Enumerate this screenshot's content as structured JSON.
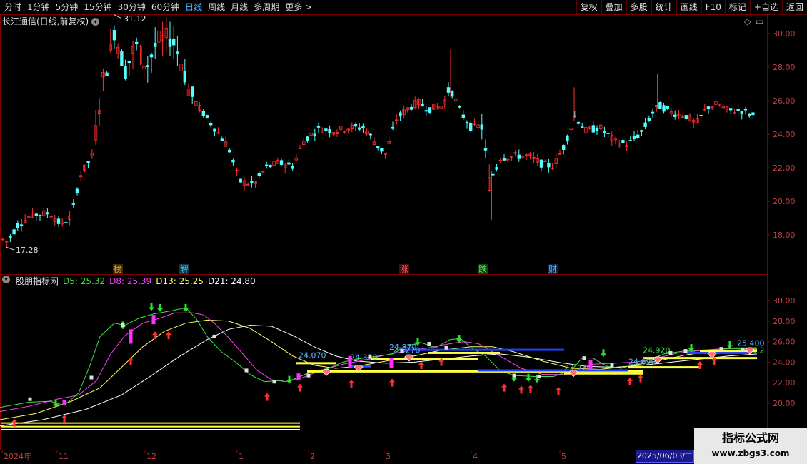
{
  "toolbar": {
    "periods": [
      "分时",
      "1分钟",
      "5分钟",
      "15分钟",
      "30分钟",
      "60分钟",
      "日线",
      "周线",
      "月线",
      "多周期",
      "更多 >"
    ],
    "active_period": "日线",
    "right_buttons": [
      "复权",
      "叠加",
      "多股",
      "统计",
      "画线",
      "F10",
      "标记",
      "+自选",
      "返回"
    ]
  },
  "main_chart": {
    "title": "长江通信(日线,前复权)",
    "y_ticks": [
      "30.00",
      "28.00",
      "26.00",
      "24.00",
      "22.00",
      "20.00",
      "18.00"
    ],
    "high_label": "31.12",
    "low_label": "17.28",
    "event_tags": [
      {
        "text": "榜",
        "color": "#e8a040",
        "bg": "#3a2a10"
      },
      {
        "text": "解",
        "color": "#40c8e8",
        "bg": "#103040"
      },
      {
        "text": "涨",
        "color": "#ff5050",
        "bg": "#401010"
      },
      {
        "text": "跌",
        "color": "#50e050",
        "bg": "#104010"
      },
      {
        "text": "财",
        "color": "#4fb4ff",
        "bg": "#102040"
      }
    ],
    "up_color": "#ff3030",
    "down_color": "#54ffff"
  },
  "indicator": {
    "name": "股朋指标网",
    "d5": "D5: 25.32",
    "d8": "D8: 25.39",
    "d13": "D13: 25.25",
    "d21": "D21: 24.80",
    "y_ticks": [
      "30.00",
      "28.00",
      "26.00",
      "24.00",
      "22.00",
      "20.00"
    ],
    "level_labels": [
      "24.070",
      "24.870",
      "25.270",
      "23.270",
      "24.920",
      "24.690",
      "25.400",
      "24.350",
      "25.2"
    ],
    "colors": {
      "d5": "#40e040",
      "d8": "#ff40ff",
      "d13": "#ffff60",
      "d21": "#ffffff"
    }
  },
  "x_axis": {
    "labels": [
      "2024年",
      "11",
      "12",
      "1",
      "2",
      "3",
      "4",
      "5"
    ],
    "cursor_date": "2025/06/03/二"
  },
  "brand": {
    "title": "指标公式网",
    "url": "www.zbgs3.com"
  }
}
